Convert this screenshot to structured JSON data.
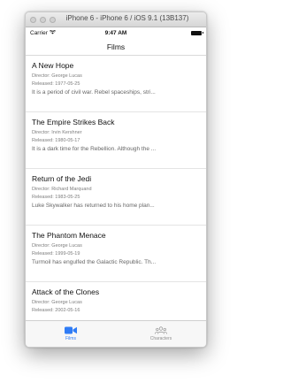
{
  "window": {
    "title": "iPhone 6 - iPhone 6 / iOS 9.1 (13B137)"
  },
  "status": {
    "carrier": "Carrier",
    "time": "9:47 AM"
  },
  "navbar": {
    "title": "Films"
  },
  "films": [
    {
      "title": "A New Hope",
      "director": "Director: George Lucas",
      "released": "Released: 1977-05-25",
      "crawl": "It is a period of civil war. Rebel spaceships, stri..."
    },
    {
      "title": "The Empire Strikes Back",
      "director": "Director: Irvin Kershner",
      "released": "Released: 1980-05-17",
      "crawl": "It is a dark time for the Rebellion. Although the ..."
    },
    {
      "title": "Return of the Jedi",
      "director": "Director: Richard Marquand",
      "released": "Released: 1983-05-25",
      "crawl": "Luke Skywalker has returned to his home plan..."
    },
    {
      "title": "The Phantom Menace",
      "director": "Director: George Lucas",
      "released": "Released: 1999-05-19",
      "crawl": "Turmoil has engulfed the Galactic Republic. Th..."
    },
    {
      "title": "Attack of the Clones",
      "director": "Director: George Lucas",
      "released": "Released: 2002-05-16",
      "crawl": ""
    }
  ],
  "tabs": [
    {
      "label": "Films",
      "icon": "video-camera-icon",
      "active": true
    },
    {
      "label": "Characters",
      "icon": "people-icon",
      "active": false
    }
  ],
  "colors": {
    "accent": "#2f7cf6",
    "inactive_tab": "#8e8e8e"
  }
}
